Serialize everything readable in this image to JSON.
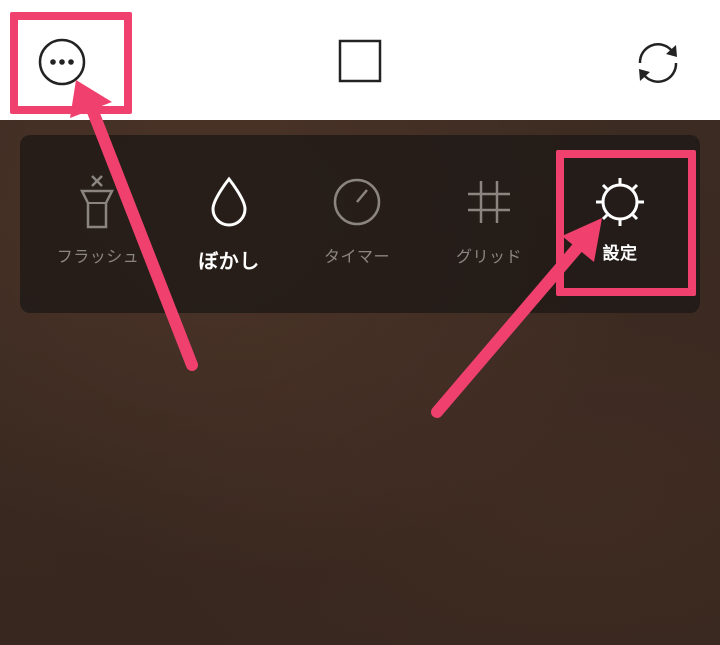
{
  "top_bar": {
    "more_icon": "more-circle-icon",
    "aspect_icon": "square-aspect-icon",
    "flip_icon": "camera-flip-icon"
  },
  "options": [
    {
      "label": "フラッシュ",
      "icon": "flash-off-icon",
      "active": false
    },
    {
      "label": "ぼかし",
      "icon": "blur-drop-icon",
      "active": true
    },
    {
      "label": "タイマー",
      "icon": "timer-icon",
      "active": false
    },
    {
      "label": "グリッド",
      "icon": "grid-icon",
      "active": false
    },
    {
      "label": "設定",
      "icon": "settings-gear-icon",
      "active": false
    }
  ],
  "annotation": {
    "highlight_color": "#f0416e"
  }
}
